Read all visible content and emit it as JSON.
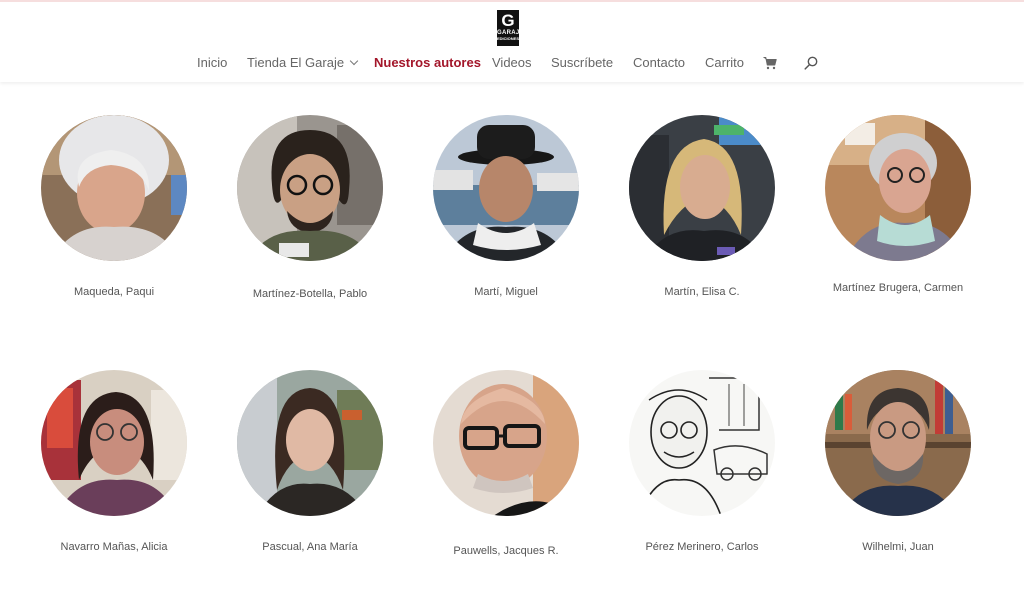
{
  "header": {
    "logo_text_top": "GARAJE",
    "logo_text_bottom": "EDICIONES",
    "logo_letter": "G"
  },
  "nav": {
    "items": [
      {
        "label": "Inicio"
      },
      {
        "label": "Tienda El Garaje"
      },
      {
        "label": "Nuestros autores"
      },
      {
        "label": "Videos"
      },
      {
        "label": "Suscríbete"
      },
      {
        "label": "Contacto"
      },
      {
        "label": "Carrito"
      }
    ],
    "active_color": "#a3162a",
    "cart_icon": "shopping-cart-icon",
    "search_icon": "search-icon"
  },
  "authors": [
    {
      "name": "Maqueda, Paqui"
    },
    {
      "name": "Martínez-Botella, Pablo"
    },
    {
      "name": "Martí, Miguel"
    },
    {
      "name": "Martín, Elisa C."
    },
    {
      "name": "Martínez Brugera, Carmen"
    },
    {
      "name": "Navarro Mañas, Alicia"
    },
    {
      "name": "Pascual, Ana María"
    },
    {
      "name": "Pauwells, Jacques R."
    },
    {
      "name": "Pérez Merinero, Carlos"
    },
    {
      "name": "Wilhelmi, Juan"
    }
  ]
}
